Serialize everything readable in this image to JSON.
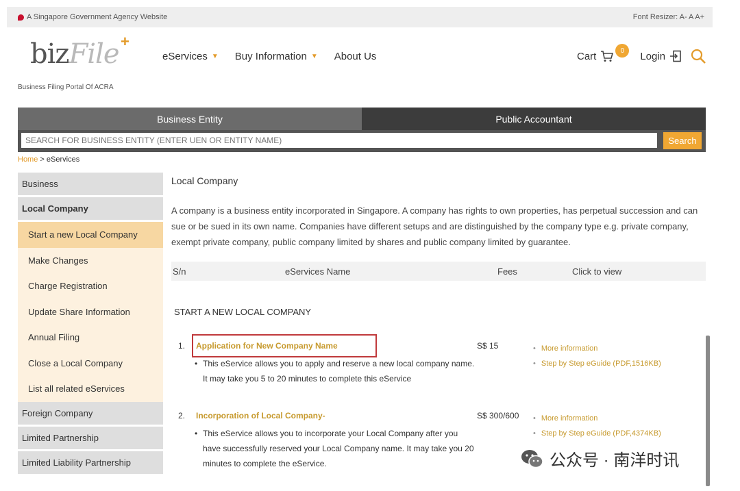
{
  "topbar": {
    "gov_label": "A Singapore Government Agency Website",
    "font_resizer": "Font Resizer: A- A A+"
  },
  "logo": {
    "text_biz": "biz",
    "text_file": "File",
    "plus": "+",
    "tagline": "Business Filing Portal Of ACRA"
  },
  "nav": {
    "eservices": "eServices",
    "buy_information": "Buy Information",
    "about_us": "About Us",
    "cart": "Cart",
    "cart_count": "0",
    "login": "Login"
  },
  "tabs": {
    "business_entity": "Business Entity",
    "public_accountant": "Public Accountant"
  },
  "search": {
    "placeholder": "SEARCH FOR BUSINESS ENTITY (ENTER UEN OR ENTITY NAME)",
    "button": "Search"
  },
  "breadcrumb": {
    "home": "Home",
    "separator": " > ",
    "current": "eServices"
  },
  "sidebar": {
    "business": "Business",
    "local_company": "Local Company",
    "sub_items": [
      "Start a new Local Company",
      "Make Changes",
      "Charge Registration",
      "Update Share Information",
      "Annual Filing",
      "Close a Local Company",
      "List all related eServices"
    ],
    "foreign_company": "Foreign Company",
    "limited_partnership": "Limited Partnership",
    "llp": "Limited Liability Partnership"
  },
  "content": {
    "title": "Local Company",
    "intro": "A company is a business entity incorporated in Singapore. A company has rights to own properties, has perpetual succession and can sue or be sued in its own name. Companies have different setups and are distinguished by the company type e.g. private company, exempt private company, public company limited by shares and public company limited by guarantee.",
    "table_headers": {
      "sn": "S/n",
      "name": "eServices Name",
      "fees": "Fees",
      "view": "Click to view"
    },
    "section_heading": "START A NEW LOCAL COMPANY",
    "rows": [
      {
        "num": "1.",
        "name": "Application for New Company Name",
        "desc": "This eService allows you to apply and reserve a new local company name. It may take you 5 to 20 minutes to complete this eService",
        "fee": "S$ 15",
        "link1": "More information",
        "link2": "Step by Step eGuide (PDF,1516KB)"
      },
      {
        "num": "2.",
        "name": "Incorporation of Local Company-",
        "desc": "This eService allows you to incorporate your Local Company after you have successfully reserved your Local Company name. It may take you 20 minutes to complete the eService.",
        "fee": "S$ 300/600",
        "link1": "More information",
        "link2": "Step by Step eGuide (PDF,4374KB)"
      }
    ]
  },
  "watermark": {
    "text": "公众号 · 南洋时讯"
  },
  "colors": {
    "accent": "#f0a733",
    "link": "#c79a2e",
    "highlight_box": "#c0393b"
  }
}
